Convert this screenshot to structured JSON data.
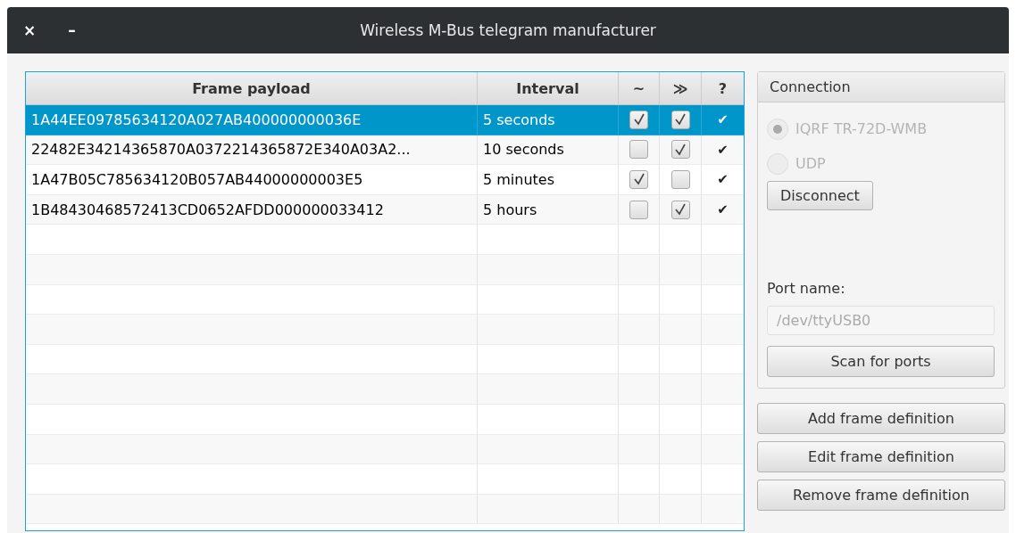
{
  "window": {
    "title": "Wireless M-Bus telegram manufacturer",
    "controls": [
      "×",
      "–"
    ]
  },
  "table": {
    "columns": [
      "Frame payload",
      "Interval",
      "~",
      "≫",
      "?"
    ],
    "rows": [
      {
        "payload": "1A44EE09785634120A027AB400000000036E",
        "interval": "5 seconds",
        "col_3": true,
        "col_4": true,
        "col_5": "✔",
        "selected": true
      },
      {
        "payload": "22482E34214365870A0372214365872E340A03A2...",
        "interval": "10 seconds",
        "col_3": false,
        "col_4": true,
        "col_5": "✔",
        "selected": false
      },
      {
        "payload": "1A47B05C785634120B057AB44000000003E5",
        "interval": "5 minutes",
        "col_3": true,
        "col_4": false,
        "col_5": "✔",
        "selected": false
      },
      {
        "payload": "1B48430468572413CD0652AFDD000000033412",
        "interval": "5 hours",
        "col_3": false,
        "col_4": true,
        "col_5": "✔",
        "selected": false
      }
    ]
  },
  "connection": {
    "title": "Connection",
    "options": [
      {
        "label": "IQRF TR-72D-WMB",
        "selected": true,
        "disabled": true
      },
      {
        "label": "UDP",
        "selected": false,
        "disabled": true
      }
    ],
    "disconnect_button": "Disconnect",
    "port_label": "Port name:",
    "port_field": {
      "value": "/dev/ttyUSB0",
      "disabled": true
    },
    "scan_button": "Scan for ports"
  },
  "buttons": [
    "Add frame definition",
    "Edit frame definition",
    "Remove frame definition"
  ]
}
